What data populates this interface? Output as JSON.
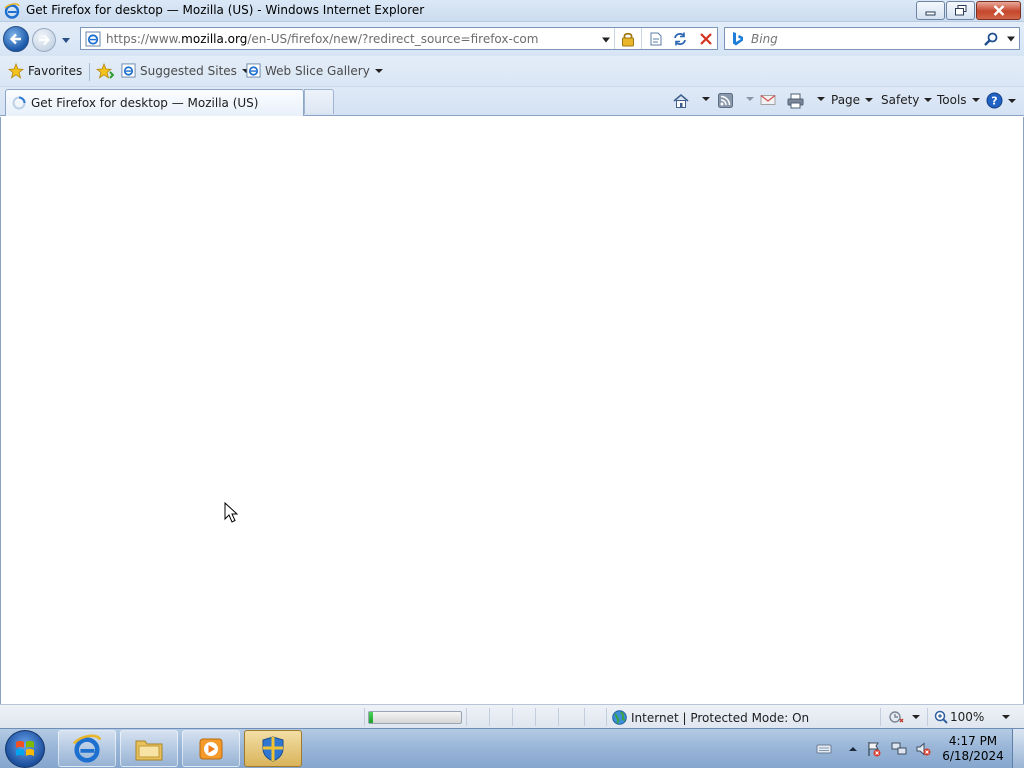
{
  "window": {
    "title": "Get Firefox for desktop — Mozilla (US) - Windows Internet Explorer",
    "icon": "ie-icon",
    "controls": [
      "minimize-icon",
      "restore-icon",
      "close-icon"
    ]
  },
  "navigation": {
    "address_prefix": "https://www.",
    "address_domain": "mozilla.org",
    "address_path": "/en-US/firefox/new/?redirect_source=firefox-com",
    "search_placeholder": "Bing",
    "icons": [
      "back-arrow-icon",
      "forward-icon",
      "history-dropdown-icon",
      "lock-icon",
      "compatibility-view-icon",
      "refresh-icon",
      "stop-icon",
      "bing-icon",
      "search-icon"
    ]
  },
  "favorites_bar": {
    "favorites_label": "Favorites",
    "suggested_sites_label": "Suggested Sites",
    "web_slice_gallery_label": "Web Slice Gallery"
  },
  "tabs": [
    {
      "label": "Get Firefox for desktop — Mozilla (US)",
      "loading": true
    }
  ],
  "command_bar": {
    "page_label": "Page",
    "safety_label": "Safety",
    "tools_label": "Tools",
    "icons": [
      "home-icon",
      "feeds-icon",
      "read-mail-icon",
      "print-icon",
      "help-icon"
    ]
  },
  "status_bar": {
    "zone_text": "Internet | Protected Mode: On",
    "zoom": "100%",
    "progress": 0.04
  },
  "taskbar": {
    "pinned": [
      "internet-explorer",
      "windows-explorer",
      "media-player",
      "security-shield"
    ],
    "time": "4:17 PM",
    "date": "6/18/2024"
  },
  "colors": {
    "progress_green": "#19a12b",
    "close_red": "#c5462c",
    "ie_blue": "#1a57a8"
  }
}
